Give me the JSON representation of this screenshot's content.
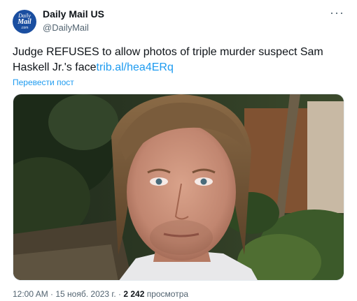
{
  "account": {
    "avatar_lines": [
      "Daily",
      "Mail",
      ".com"
    ],
    "name": "Daily Mail US",
    "handle": "@DailyMail"
  },
  "menu_icon": "more-horizontal-icon",
  "menu_glyph": "···",
  "tweet": {
    "text": "Judge REFUSES to allow photos of triple murder suspect Sam Haskell Jr.'s face",
    "link": "trib.al/hea4ERq",
    "translate_label": "Перевести пост"
  },
  "meta": {
    "time": "12:00 AM",
    "separator1": " · ",
    "date": "15 нояб. 2023 г.",
    "separator2": " · ",
    "views_count": "2 242",
    "views_label": " просмотра"
  },
  "colors": {
    "accent": "#1d9bf0",
    "avatar_bg": "#1a4ea0",
    "secondary_text": "#536471"
  }
}
